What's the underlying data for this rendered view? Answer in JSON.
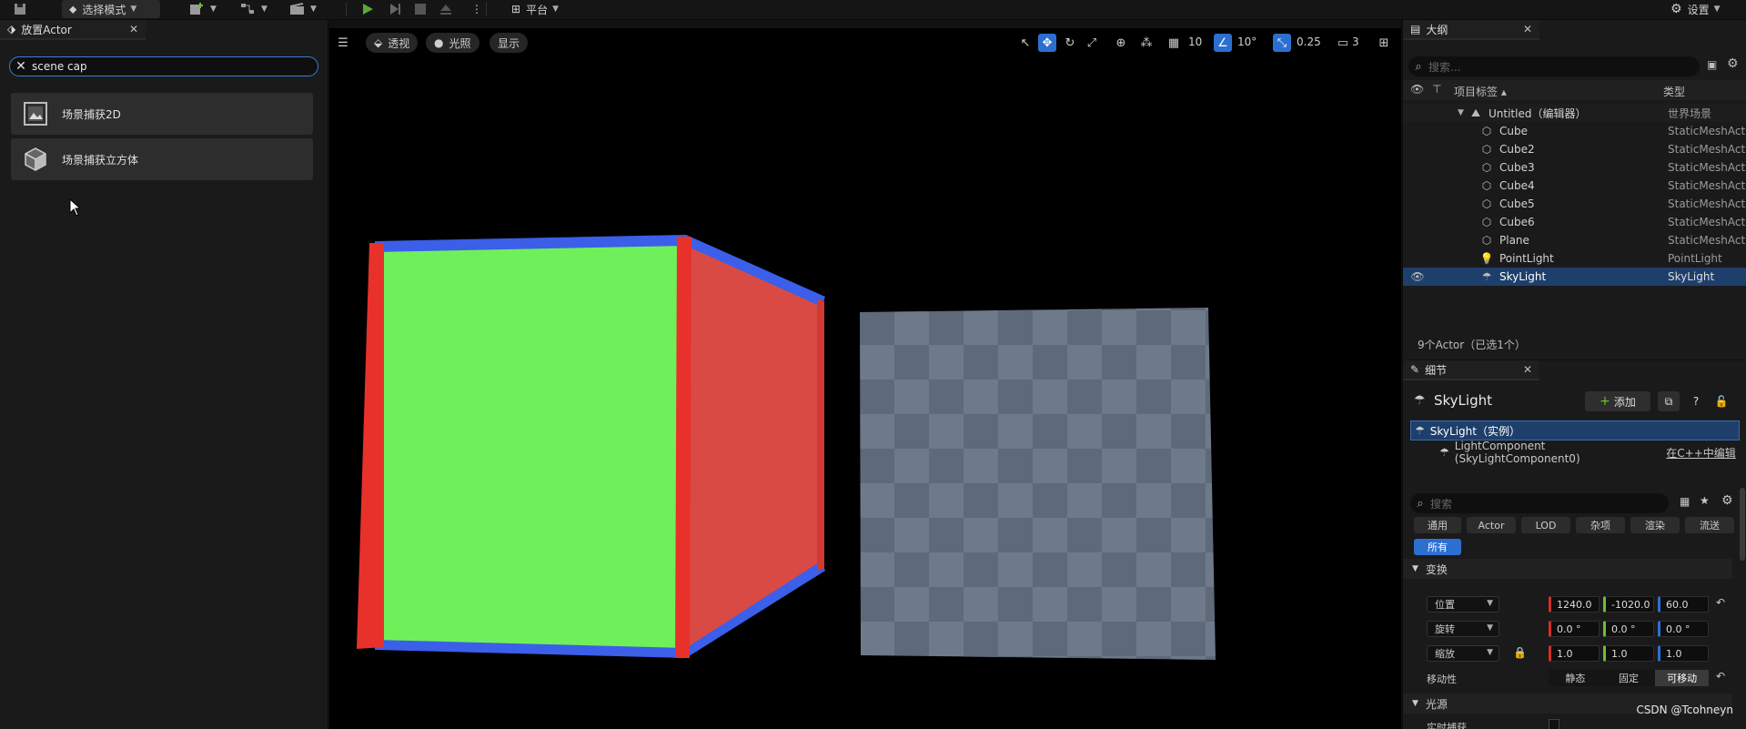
{
  "toolbar": {
    "mode_label": "选择模式",
    "platform_label": "平台",
    "settings_label": "设置"
  },
  "place_actors": {
    "tab_title": "放置Actor",
    "search_value": "scene cap",
    "results": [
      {
        "label": "场景捕获2D",
        "icon": "scene-capture-2d-icon"
      },
      {
        "label": "场景捕获立方体",
        "icon": "scene-capture-cube-icon"
      }
    ]
  },
  "viewport": {
    "menu_label": "",
    "perspective_label": "透视",
    "lit_label": "光照",
    "show_label": "显示",
    "grid_snap": "10",
    "rotate_snap": "10°",
    "scale_snap": "0.25",
    "camera_speed": "3"
  },
  "outliner": {
    "tab_title": "大纲",
    "search_placeholder": "搜索...",
    "col_label": "项目标签 ▴",
    "col_type": "类型",
    "world": {
      "name": "Untitled（编辑器）",
      "type": "世界场景"
    },
    "actors": [
      {
        "name": "Cube",
        "type": "StaticMeshAct"
      },
      {
        "name": "Cube2",
        "type": "StaticMeshAct"
      },
      {
        "name": "Cube3",
        "type": "StaticMeshAct"
      },
      {
        "name": "Cube4",
        "type": "StaticMeshAct"
      },
      {
        "name": "Cube5",
        "type": "StaticMeshAct"
      },
      {
        "name": "Cube6",
        "type": "StaticMeshAct"
      },
      {
        "name": "Plane",
        "type": "StaticMeshAct"
      },
      {
        "name": "PointLight",
        "type": "PointLight"
      },
      {
        "name": "SkyLight",
        "type": "SkyLight"
      }
    ],
    "summary": "9个Actor（已选1个）"
  },
  "details": {
    "tab_title": "细节",
    "actor_name": "SkyLight",
    "add_label": "添加",
    "instance_label": "SkyLight（实例）",
    "component_label": "LightComponent (SkyLightComponent0)",
    "cpp_link": "在C++中编辑",
    "search_placeholder": "搜索",
    "filters": [
      "通用",
      "Actor",
      "LOD",
      "杂项",
      "渲染",
      "流送",
      "所有"
    ],
    "transform_section": "变换",
    "location_label": "位置",
    "rotation_label": "旋转",
    "scale_label": "缩放",
    "location": [
      "1240.0",
      "-1020.0",
      "60.0"
    ],
    "rotation": [
      "0.0 °",
      "0.0 °",
      "0.0 °"
    ],
    "scale": [
      "1.0",
      "1.0",
      "1.0"
    ],
    "mobility_label": "移动性",
    "mobility_options": [
      "静态",
      "固定",
      "可移动"
    ],
    "light_section": "光源",
    "realtime_capture_label": "实时捕获"
  },
  "watermark": "CSDN @Tcohneyn",
  "colors": {
    "accent": "#2d6fd1",
    "cube_front": "#6fef5a",
    "cube_side": "#e0554f",
    "cube_edge_red": "#e8312a",
    "cube_edge_blue": "#3b5fe8",
    "plane": "#6b7788"
  }
}
